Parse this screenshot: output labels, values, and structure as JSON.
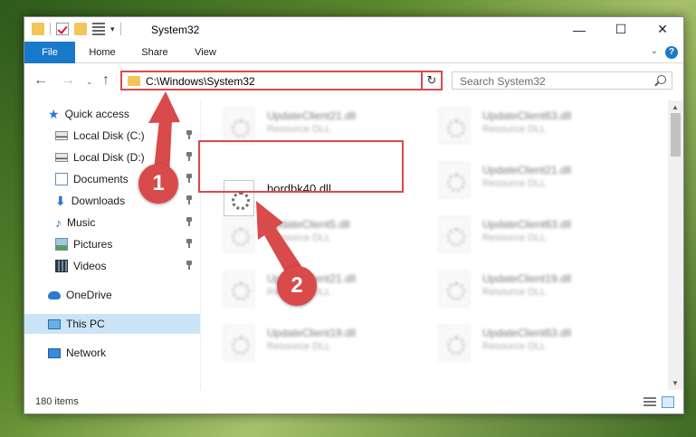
{
  "window": {
    "title": "System32",
    "controls": {
      "minimize": "—",
      "maximize": "☐",
      "close": "✕"
    }
  },
  "ribbon": {
    "tabs": [
      "File",
      "Home",
      "Share",
      "View"
    ],
    "help": "?",
    "caret": "⌄"
  },
  "nav": {
    "back": "←",
    "forward": "→",
    "recent": "⌄",
    "up": "↑",
    "address": "C:\\Windows\\System32",
    "address_dropdown": "⌄",
    "refresh": "↻",
    "search_placeholder": "Search System32"
  },
  "sidebar": {
    "items": [
      {
        "label": "Quick access",
        "icon": "star-icon"
      },
      {
        "label": "Local Disk (C:)",
        "icon": "disk-icon",
        "pinned": true
      },
      {
        "label": "Local Disk (D:)",
        "icon": "disk-icon",
        "pinned": true
      },
      {
        "label": "Documents",
        "icon": "documents-icon",
        "pinned": true
      },
      {
        "label": "Downloads",
        "icon": "download-icon",
        "pinned": true
      },
      {
        "label": "Music",
        "icon": "music-icon",
        "pinned": true
      },
      {
        "label": "Pictures",
        "icon": "pictures-icon",
        "pinned": true
      },
      {
        "label": "Videos",
        "icon": "videos-icon",
        "pinned": true
      },
      {
        "label": "OneDrive",
        "icon": "cloud-icon"
      },
      {
        "label": "This PC",
        "icon": "computer-icon",
        "selected": true
      },
      {
        "label": "Network",
        "icon": "network-icon"
      }
    ]
  },
  "content": {
    "focus_file": {
      "name": "bordbk40.dll"
    },
    "background_files": [
      {
        "name": "UpdateClient21.dll",
        "type": "Resource DLL"
      },
      {
        "name": "UpdateClient63.dll",
        "type": "Resource DLL"
      },
      {
        "name": "UpdateClient21.dll",
        "type": "Resource DLL"
      },
      {
        "name": "UpdateClient5.dll",
        "type": "Resource DLL"
      },
      {
        "name": "UpdateClient63.dll",
        "type": "Resource DLL"
      },
      {
        "name": "UpdateClient21.dll",
        "type": "Resource DLL"
      },
      {
        "name": "UpdateClient19.dll",
        "type": "Resource DLL"
      },
      {
        "name": "UpdateClient19.dll",
        "type": "Resource DLL"
      },
      {
        "name": "UpdateClient63.dll",
        "type": "Resource DLL"
      }
    ]
  },
  "status": {
    "item_count": "180 items"
  },
  "annotations": {
    "step1": "1",
    "step2": "2",
    "color": "#d94a4a"
  }
}
